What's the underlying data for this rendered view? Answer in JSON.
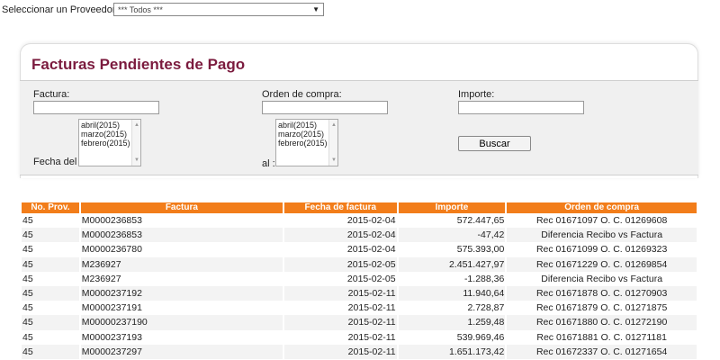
{
  "supplier": {
    "label": "Seleccionar un Proveedor",
    "selected": "*** Todos ***"
  },
  "page_title": "Facturas Pendientes de Pago",
  "filters": {
    "factura_label": "Factura:",
    "factura_value": "",
    "orden_label": "Orden de compra:",
    "orden_value": "",
    "importe_label": "Importe:",
    "importe_value": "",
    "fecha_del_label": "Fecha del :",
    "al_label": "al :",
    "months_from": [
      "abril(2015)",
      "marzo(2015)",
      "febrero(2015)"
    ],
    "months_to": [
      "abril(2015)",
      "marzo(2015)",
      "febrero(2015)"
    ],
    "search_label": "Buscar"
  },
  "table": {
    "headers": [
      "No. Prov.",
      "Factura",
      "Fecha de factura",
      "Importe",
      "Orden de compra"
    ],
    "rows": [
      [
        "45",
        "M0000236853",
        "2015-02-04",
        "572.447,65",
        "Rec 01671097 O. C. 01269608"
      ],
      [
        "45",
        "M0000236853",
        "2015-02-04",
        "-47,42",
        "Diferencia Recibo vs Factura"
      ],
      [
        "45",
        "M0000236780",
        "2015-02-04",
        "575.393,00",
        "Rec 01671099 O. C. 01269323"
      ],
      [
        "45",
        "M236927",
        "2015-02-05",
        "2.451.427,97",
        "Rec 01671229 O. C. 01269854"
      ],
      [
        "45",
        "M236927",
        "2015-02-05",
        "-1.288,36",
        "Diferencia Recibo vs Factura"
      ],
      [
        "45",
        "M0000237192",
        "2015-02-11",
        "11.940,64",
        "Rec 01671878 O. C. 01270903"
      ],
      [
        "45",
        "M0000237191",
        "2015-02-11",
        "2.728,87",
        "Rec 01671879 O. C. 01271875"
      ],
      [
        "45",
        "M00000237190",
        "2015-02-11",
        "1.259,48",
        "Rec 01671880 O. C. 01272190"
      ],
      [
        "45",
        "M0000237193",
        "2015-02-11",
        "539.969,46",
        "Rec 01671881 O. C. 01271181"
      ],
      [
        "45",
        "M0000237297",
        "2015-02-11",
        "1.651.173,42",
        "Rec 01672337 O. C. 01271654"
      ]
    ]
  }
}
